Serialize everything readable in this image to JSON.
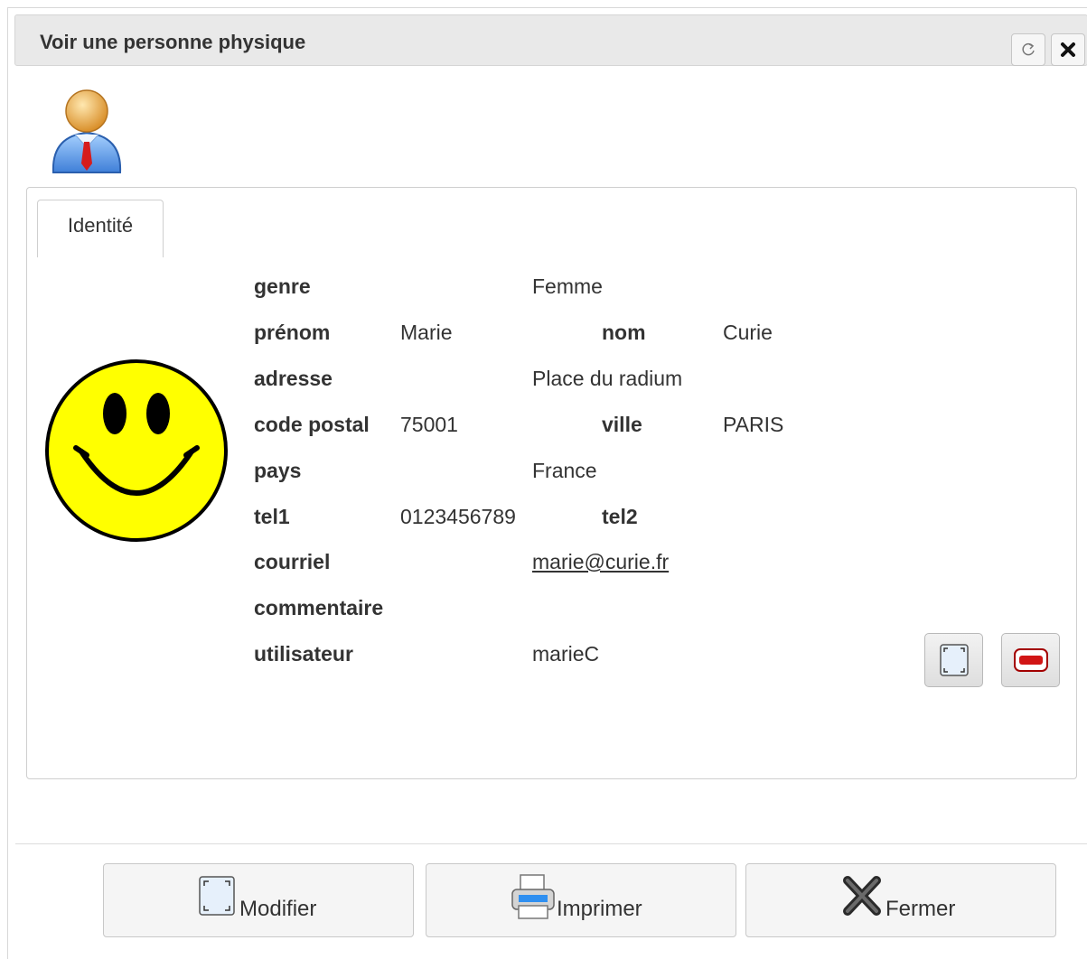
{
  "window": {
    "title": "Voir une personne physique",
    "refresh_icon": "refresh-icon",
    "close_icon": "close-icon"
  },
  "header_icon": "person-avatar-icon",
  "tabs": [
    {
      "label": "Identité",
      "active": true
    }
  ],
  "photo_icon": "smiley-face-icon",
  "fields": {
    "genre": {
      "label": "genre",
      "value": "Femme"
    },
    "prenom": {
      "label": "prénom",
      "value": "Marie"
    },
    "nom": {
      "label": "nom",
      "value": "Curie"
    },
    "adresse": {
      "label": "adresse",
      "value": "Place du radium"
    },
    "code_postal": {
      "label": "code postal",
      "value": "75001"
    },
    "ville": {
      "label": "ville",
      "value": "PARIS"
    },
    "pays": {
      "label": "pays",
      "value": "France"
    },
    "tel1": {
      "label": "tel1",
      "value": "0123456789"
    },
    "tel2": {
      "label": "tel2",
      "value": ""
    },
    "courriel": {
      "label": "courriel",
      "value": "marie@curie.fr"
    },
    "commentaire": {
      "label": "commentaire",
      "value": ""
    },
    "utilisateur": {
      "label": "utilisateur",
      "value": "marieC"
    }
  },
  "record_actions": [
    {
      "name": "edit-record-button",
      "icon": "edit-frame-icon"
    },
    {
      "name": "delete-record-button",
      "icon": "delete-minus-icon"
    }
  ],
  "footer_buttons": {
    "modifier": {
      "label": "Modifier",
      "icon": "edit-frame-icon"
    },
    "imprimer": {
      "label": "Imprimer",
      "icon": "printer-icon"
    },
    "fermer": {
      "label": "Fermer",
      "icon": "close-x-icon"
    }
  },
  "colors": {
    "title_bar": "#e9e9e9",
    "smiley_yellow": "#ffff00",
    "delete_red": "#cc1111"
  }
}
